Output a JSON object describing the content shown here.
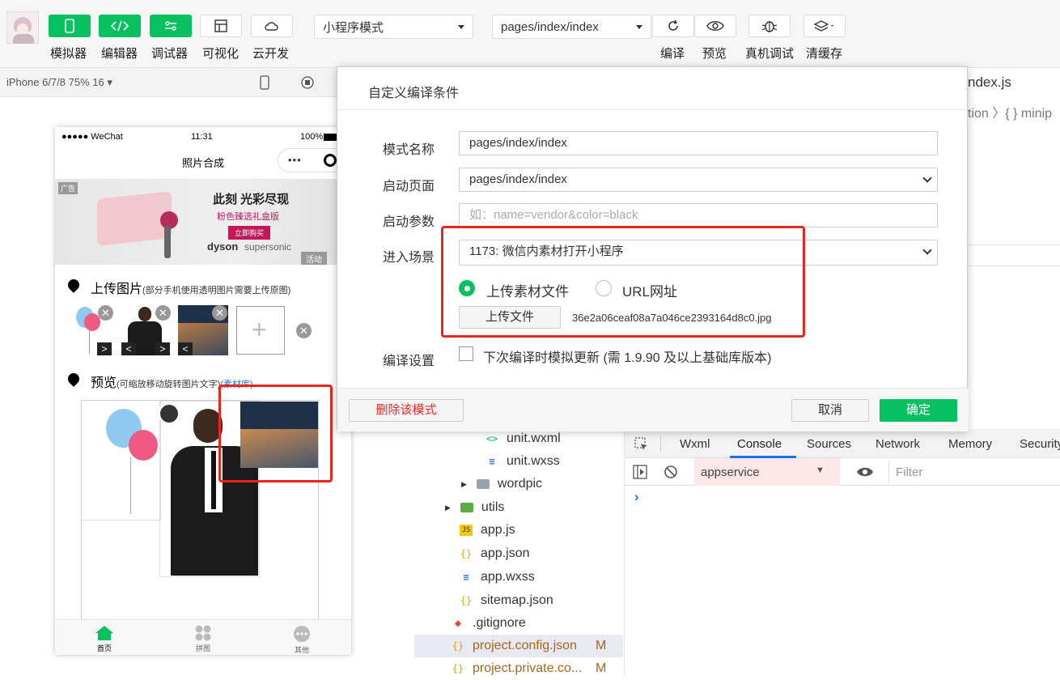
{
  "toolbar": {
    "buttons": [
      {
        "label": "模拟器",
        "icon": "phone-icon"
      },
      {
        "label": "编辑器",
        "icon": "code-icon"
      },
      {
        "label": "调试器",
        "icon": "debug-toggle-icon"
      },
      {
        "label": "可视化",
        "icon": "layout-icon"
      },
      {
        "label": "云开发",
        "icon": "cloud-icon"
      }
    ],
    "mode_select": "小程序模式",
    "page_select": "pages/index/index",
    "right_buttons": [
      {
        "label": "编译",
        "icon": "refresh-icon"
      },
      {
        "label": "预览",
        "icon": "eye-icon"
      },
      {
        "label": "真机调试",
        "icon": "bug-icon"
      },
      {
        "label": "清缓存",
        "icon": "layers-icon"
      }
    ]
  },
  "simulator": {
    "device": "iPhone 6/7/8 75% 16 ▾"
  },
  "editor": {
    "tab_file": "ndex.js",
    "breadcrumb": "tion 〉{ } minip"
  },
  "phone": {
    "status_left": "●●●●● WeChat",
    "status_time": "11:31",
    "status_battery": "100%",
    "nav_title": "照片合成",
    "ad_tag": "广告",
    "ad_line1": "此刻 光彩尽现",
    "ad_line2": "粉色臻选礼盒版",
    "ad_button": "立即购买",
    "ad_brand": "dyson",
    "ad_brand_sub": "supersonic",
    "ad_corner": "活动",
    "upload_title": "上传图片",
    "upload_note": "(部分手机使用透明图片需要上传原图)",
    "preview_title": "预览",
    "preview_note": "(可缩放移动旋转图片文字)",
    "preview_link": "(素材库)",
    "add_symbol": "+",
    "tabs": [
      {
        "label": "首页",
        "icon": "home-icon"
      },
      {
        "label": "拼图",
        "icon": "grid-icon"
      },
      {
        "label": "其他",
        "icon": "more-icon"
      }
    ]
  },
  "filetree": {
    "items": [
      {
        "name": "unit.wxml",
        "icon": "wxml-icon",
        "badge": ""
      },
      {
        "name": "unit.wxss",
        "icon": "wxss-icon",
        "badge": ""
      },
      {
        "name": "wordpic",
        "icon": "folder-icon",
        "badge": ""
      },
      {
        "name": "utils",
        "icon": "folder-icon",
        "badge": ""
      },
      {
        "name": "app.js",
        "icon": "js-icon",
        "badge": ""
      },
      {
        "name": "app.json",
        "icon": "json-icon",
        "badge": ""
      },
      {
        "name": "app.wxss",
        "icon": "wxss-icon",
        "badge": ""
      },
      {
        "name": "sitemap.json",
        "icon": "json-icon",
        "badge": ""
      },
      {
        "name": ".gitignore",
        "icon": "git-icon",
        "badge": ""
      },
      {
        "name": "project.config.json",
        "icon": "json-icon",
        "badge": "M"
      },
      {
        "name": "project.private.co...",
        "icon": "json-icon",
        "badge": "M"
      }
    ]
  },
  "devtools": {
    "tabs": [
      "Wxml",
      "Console",
      "Sources",
      "Network",
      "Memory",
      "Security"
    ],
    "active_tab": "Console",
    "context": "appservice",
    "filter_placeholder": "Filter",
    "prompt": "›"
  },
  "dialog": {
    "title": "自定义编译条件",
    "mode_name_label": "模式名称",
    "mode_name_value": "pages/index/index",
    "start_page_label": "启动页面",
    "start_page_value": "pages/index/index",
    "start_params_label": "启动参数",
    "start_params_placeholder": "如：name=vendor&color=black",
    "scene_label": "进入场景",
    "scene_value": "1173: 微信内素材打开小程序",
    "radio_upload": "上传素材文件",
    "radio_url": "URL网址",
    "upload_button": "上传文件",
    "uploaded_file": "36e2a06ceaf08a7a046ce2393164d8c0.jpg",
    "compile_label": "编译设置",
    "compile_option": "下次编译时模拟更新 (需 1.9.90 及以上基础库版本)",
    "delete_button": "删除该模式",
    "cancel_button": "取消",
    "confirm_button": "确定"
  },
  "colors": {
    "accent": "#07c160",
    "highlight": "#e8261f",
    "link": "#1a73e8"
  }
}
